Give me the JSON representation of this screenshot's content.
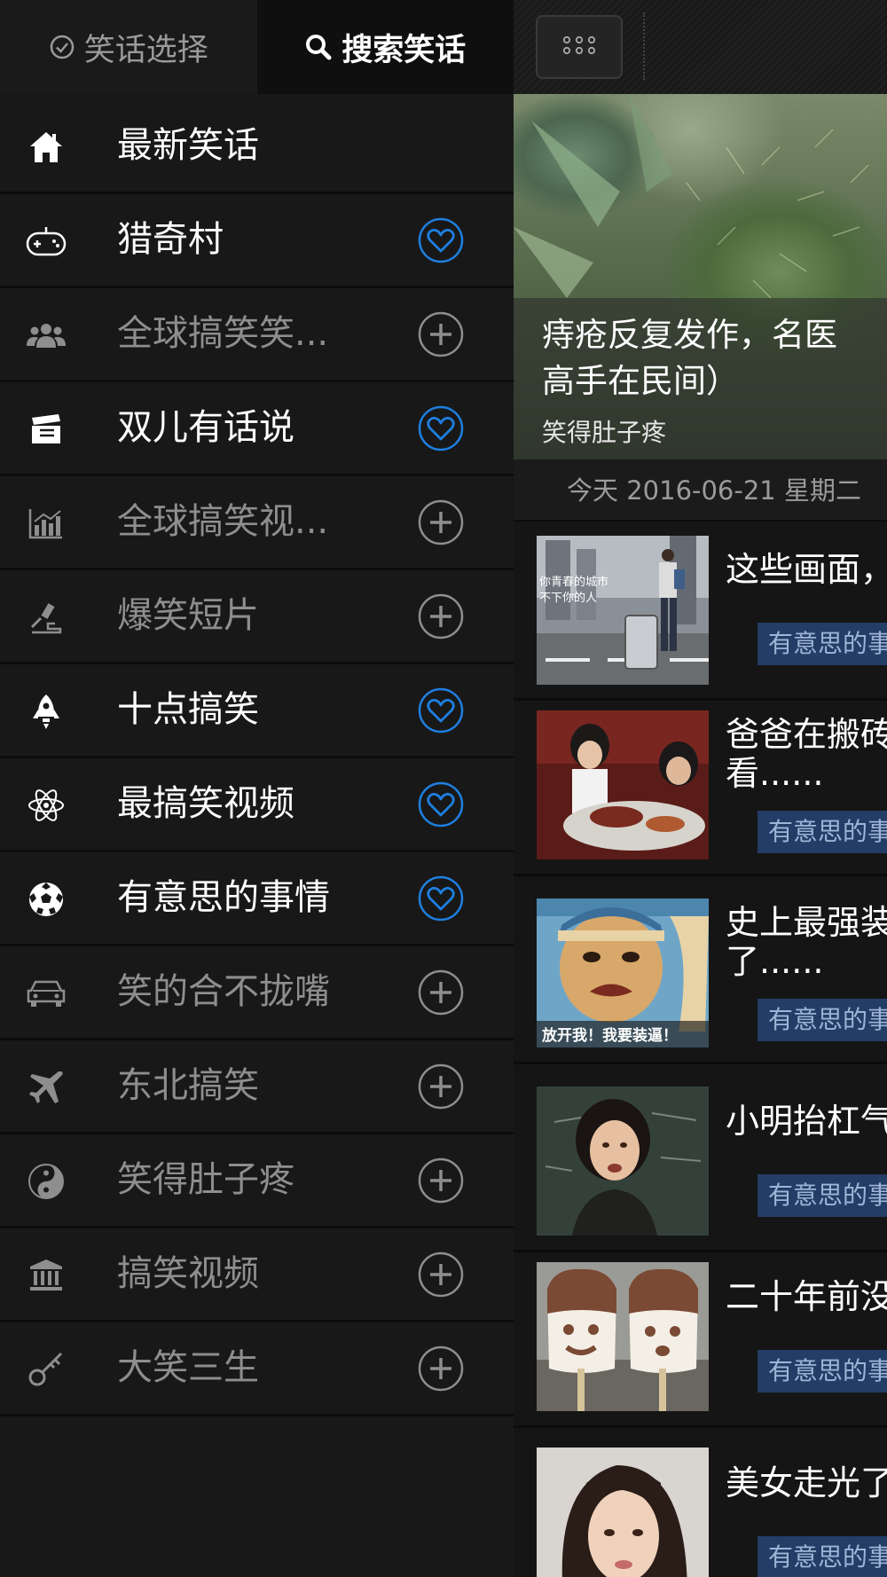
{
  "drawer": {
    "tabs": [
      {
        "label": "笑话选择",
        "icon": "check-circle-icon"
      },
      {
        "label": "搜索笑话",
        "icon": "search-icon"
      }
    ],
    "items": [
      {
        "label": "最新笑话",
        "icon": "home-icon",
        "state": "on",
        "action": "none"
      },
      {
        "label": "猎奇村",
        "icon": "gamepad-icon",
        "state": "on",
        "action": "heart"
      },
      {
        "label": "全球搞笑笑...",
        "icon": "users-icon",
        "state": "off",
        "action": "plus"
      },
      {
        "label": "双儿有话说",
        "icon": "clapperboard-icon",
        "state": "on",
        "action": "heart"
      },
      {
        "label": "全球搞笑视...",
        "icon": "bar-chart-icon",
        "state": "off",
        "action": "plus"
      },
      {
        "label": "爆笑短片",
        "icon": "lab-icon",
        "state": "off",
        "action": "plus"
      },
      {
        "label": "十点搞笑",
        "icon": "rocket-icon",
        "state": "on",
        "action": "heart"
      },
      {
        "label": "最搞笑视频",
        "icon": "atom-icon",
        "state": "on",
        "action": "heart"
      },
      {
        "label": "有意思的事情",
        "icon": "soccer-ball-icon",
        "state": "on",
        "action": "heart"
      },
      {
        "label": "笑的合不拢嘴",
        "icon": "car-icon",
        "state": "off",
        "action": "plus"
      },
      {
        "label": "东北搞笑",
        "icon": "airplane-icon",
        "state": "off",
        "action": "plus"
      },
      {
        "label": "笑得肚子疼",
        "icon": "yin-yang-icon",
        "state": "off",
        "action": "plus"
      },
      {
        "label": "搞笑视频",
        "icon": "bank-icon",
        "state": "off",
        "action": "plus"
      },
      {
        "label": "大笑三生",
        "icon": "key-icon",
        "state": "off",
        "action": "plus"
      }
    ]
  },
  "content": {
    "hero": {
      "title": "痔疮反复发作，名医\n高手在民间）",
      "source": "笑得肚子疼"
    },
    "date": "今天  2016-06-21  星期二",
    "news": [
      {
        "title": "这些画面，",
        "tag": "有意思的事",
        "thumb_caption": "你青春的城市\n不下你的人"
      },
      {
        "title": "爸爸在搬砖\n看......",
        "tag": "有意思的事",
        "thumb_caption": ""
      },
      {
        "title": "史上最强装\n了......",
        "tag": "有意思的事",
        "thumb_caption": "放开我！我要装逼！"
      },
      {
        "title": "小明抬杠气",
        "tag": "有意思的事",
        "thumb_caption": ""
      },
      {
        "title": "二十年前没",
        "tag": "有意思的事",
        "thumb_caption": ""
      },
      {
        "title": "美女走光了",
        "tag": "有意思的事",
        "thumb_caption": ""
      }
    ]
  },
  "colors": {
    "accent_blue": "#1e7fe0",
    "tag_bg": "#243d66",
    "tag_text": "#9db4d6"
  }
}
